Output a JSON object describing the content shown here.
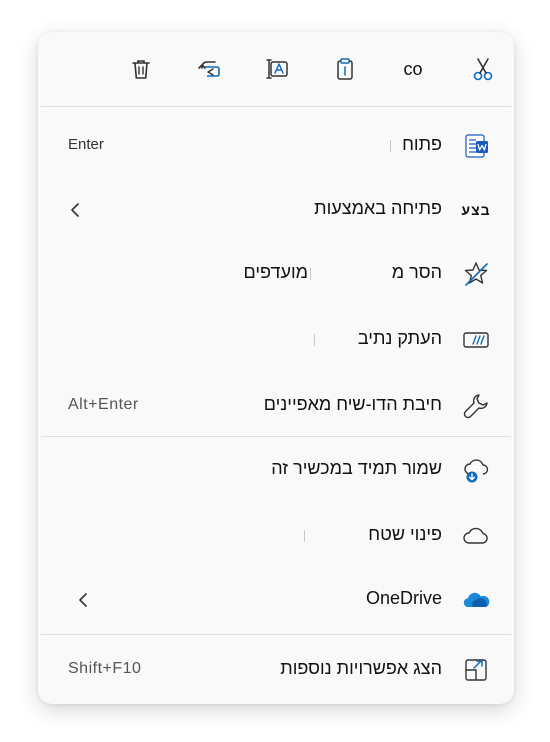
{
  "toolbar": {
    "copy_label": "co"
  },
  "menu": {
    "items": [
      {
        "label": "פתוח",
        "shortcut": "Enter"
      },
      {
        "label": "פתיחה באמצעות",
        "icon_text": "בצע"
      },
      {
        "label": "הסר מ",
        "label2": "מועדפים"
      },
      {
        "label": "העתק נתיב"
      },
      {
        "label": "חיבת הדו-שיח מאפיינים",
        "shortcut": "Alt+Enter"
      },
      {
        "label": "שמור תמיד במכשיר זה"
      },
      {
        "label": "פינוי שטח"
      },
      {
        "label": "OneDrive"
      },
      {
        "label": "הצג אפשרויות נוספות",
        "shortcut": "Shift+F10"
      }
    ]
  },
  "colors": {
    "accent": "#0f6cbd",
    "word_blue": "#185abd",
    "onedrive_blue": "#1e88d8"
  }
}
